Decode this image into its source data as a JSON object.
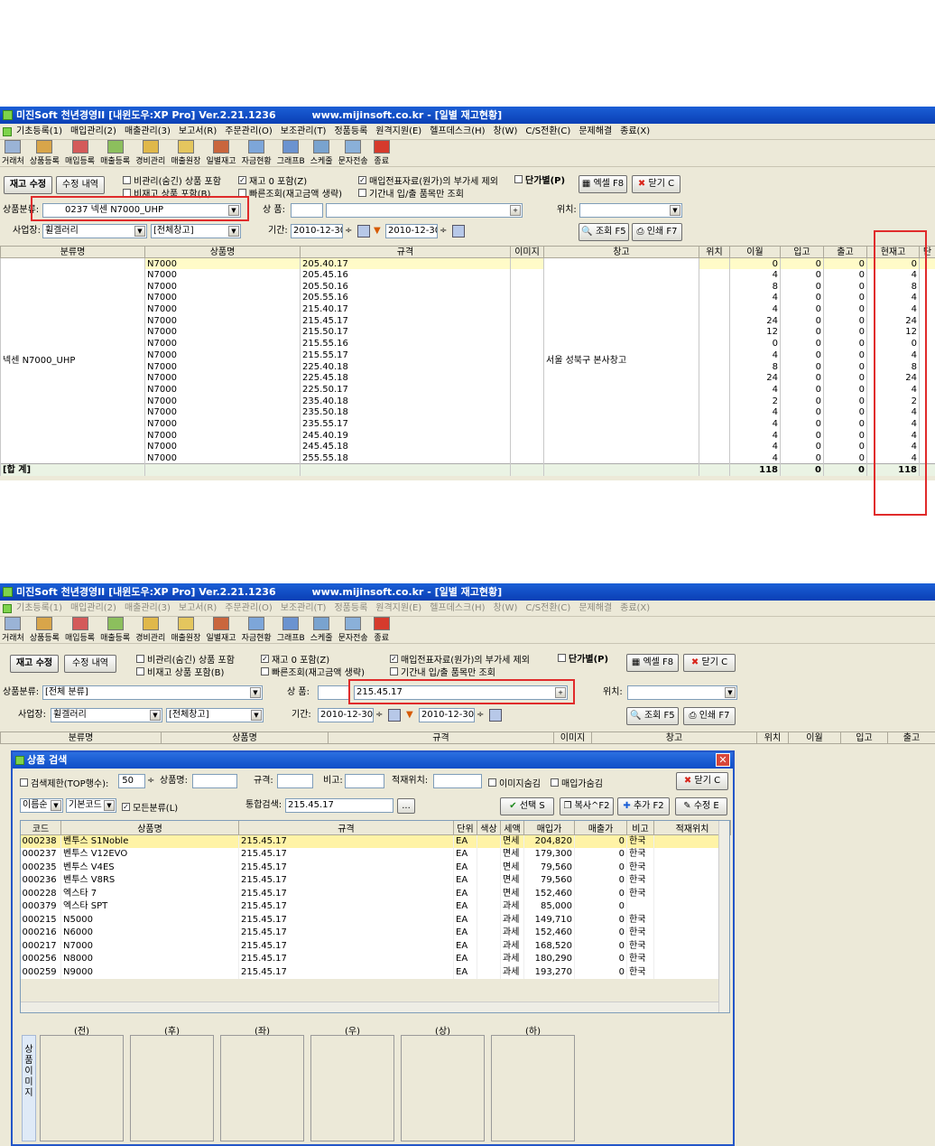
{
  "app_title": "미진Soft 천년경영II [내윈도우:XP Pro] Ver.2.21.1236",
  "url": "www.mijinsoft.co.kr",
  "window_title": "- [일별 재고현황]",
  "menu": [
    "기초등록(1)",
    "매입관리(2)",
    "매출관리(3)",
    "보고서(R)",
    "주문관리(O)",
    "보조관리(T)",
    "정품등록",
    "원격지원(E)",
    "헬프데스크(H)",
    "창(W)",
    "C/S전환(C)",
    "문제해결",
    "종료(X)"
  ],
  "toolbar": [
    "거래처",
    "상품등록",
    "매입등록",
    "매출등록",
    "경비관리",
    "매출원장",
    "일별재고",
    "자금현황",
    "그래프B",
    "스케줄",
    "문자전송",
    "종료"
  ],
  "buttons": {
    "stock_edit": "재고 수정",
    "edit_history": "수정 내역",
    "excel": "엑셀 F8",
    "close": "닫기 C",
    "search": "조회 F5",
    "print": "인쇄 F7"
  },
  "options": {
    "include_hidden": "비관리(숨긴) 상품 포함",
    "include_nonstock": "비재고 상품 포함(B)",
    "include_zero": "재고 0 포함(Z)",
    "quick_search": "빠른조회(재고금액 생략)",
    "exclude_vat": "매입전표자료(원가)의 부가세 제외",
    "period_only": "기간내 입/출 품목만 조회",
    "unit_price": "단가별(P)"
  },
  "filters": {
    "category_label": "상품분류:",
    "product_label": "상 품:",
    "location_label": "위치:",
    "site_label": "사업장:",
    "period_label": "기간:",
    "site_value": "휠겔러리",
    "warehouse_value": "[전체창고]",
    "date_from": "2010-12-30",
    "date_to": "2010-12-30"
  },
  "win1": {
    "category_value": "0237 넥센 N7000_UHP",
    "product_value": "",
    "columns": [
      "분류명",
      "상품명",
      "규격",
      "이미지",
      "창고",
      "위치",
      "이월",
      "입고",
      "출고",
      "현재고",
      "단"
    ],
    "group_name": "넥센 N7000_UHP",
    "warehouse_name": "서울 성북구 본사창고",
    "rows": [
      {
        "name": "N7000",
        "spec": "205.40.17",
        "carry": "0",
        "in": "0",
        "out": "0",
        "stock": "0"
      },
      {
        "name": "N7000",
        "spec": "205.45.16",
        "carry": "4",
        "in": "0",
        "out": "0",
        "stock": "4"
      },
      {
        "name": "N7000",
        "spec": "205.50.16",
        "carry": "8",
        "in": "0",
        "out": "0",
        "stock": "8"
      },
      {
        "name": "N7000",
        "spec": "205.55.16",
        "carry": "4",
        "in": "0",
        "out": "0",
        "stock": "4"
      },
      {
        "name": "N7000",
        "spec": "215.40.17",
        "carry": "4",
        "in": "0",
        "out": "0",
        "stock": "4"
      },
      {
        "name": "N7000",
        "spec": "215.45.17",
        "carry": "24",
        "in": "0",
        "out": "0",
        "stock": "24"
      },
      {
        "name": "N7000",
        "spec": "215.50.17",
        "carry": "12",
        "in": "0",
        "out": "0",
        "stock": "12"
      },
      {
        "name": "N7000",
        "spec": "215.55.16",
        "carry": "0",
        "in": "0",
        "out": "0",
        "stock": "0"
      },
      {
        "name": "N7000",
        "spec": "215.55.17",
        "carry": "4",
        "in": "0",
        "out": "0",
        "stock": "4"
      },
      {
        "name": "N7000",
        "spec": "225.40.18",
        "carry": "8",
        "in": "0",
        "out": "0",
        "stock": "8"
      },
      {
        "name": "N7000",
        "spec": "225.45.18",
        "carry": "24",
        "in": "0",
        "out": "0",
        "stock": "24"
      },
      {
        "name": "N7000",
        "spec": "225.50.17",
        "carry": "4",
        "in": "0",
        "out": "0",
        "stock": "4"
      },
      {
        "name": "N7000",
        "spec": "235.40.18",
        "carry": "2",
        "in": "0",
        "out": "0",
        "stock": "2"
      },
      {
        "name": "N7000",
        "spec": "235.50.18",
        "carry": "4",
        "in": "0",
        "out": "0",
        "stock": "4"
      },
      {
        "name": "N7000",
        "spec": "235.55.17",
        "carry": "4",
        "in": "0",
        "out": "0",
        "stock": "4"
      },
      {
        "name": "N7000",
        "spec": "245.40.19",
        "carry": "4",
        "in": "0",
        "out": "0",
        "stock": "4"
      },
      {
        "name": "N7000",
        "spec": "245.45.18",
        "carry": "4",
        "in": "0",
        "out": "0",
        "stock": "4"
      },
      {
        "name": "N7000",
        "spec": "255.55.18",
        "carry": "4",
        "in": "0",
        "out": "0",
        "stock": "4"
      }
    ],
    "total": {
      "label": "[합 계]",
      "carry": "118",
      "in": "0",
      "out": "0",
      "stock": "118"
    }
  },
  "win2": {
    "category_value": "[전체 분류]",
    "product_value": "215.45.17",
    "columns": [
      "분류명",
      "상품명",
      "규격",
      "이미지",
      "창고",
      "위치",
      "이월",
      "입고",
      "출고"
    ]
  },
  "dialog": {
    "title": "상품 검색",
    "top_limit_label": "검색제한(TOP행수):",
    "top_limit_value": "50",
    "name_label": "상품명:",
    "spec_label": "규격:",
    "note_label": "비고:",
    "location_label": "적재위치:",
    "hide_image": "이미지숨김",
    "include_purchase": "매입가숨김",
    "close": "닫기 C",
    "sort_value": "이름순",
    "code_value": "기본코드",
    "all_category": "모든분류(L)",
    "integrated_label": "통합검색:",
    "integrated_value": "215.45.17",
    "ellipsis": "...",
    "select": "선택 S",
    "copy": "복사^F2",
    "add": "추가 F2",
    "edit": "수정 E",
    "columns": [
      "코드",
      "상품명",
      "규격",
      "단위",
      "색상",
      "세액",
      "매입가",
      "매출가",
      "비고",
      "적재위치"
    ],
    "rows": [
      {
        "code": "000238",
        "name": "벤투스 S1Noble",
        "spec": "215.45.17",
        "unit": "EA",
        "tax": "면세",
        "buy": "204,820",
        "sell": "0",
        "note": "한국"
      },
      {
        "code": "000237",
        "name": "벤투스 V12EVO",
        "spec": "215.45.17",
        "unit": "EA",
        "tax": "면세",
        "buy": "179,300",
        "sell": "0",
        "note": "한국"
      },
      {
        "code": "000235",
        "name": "벤투스 V4ES",
        "spec": "215.45.17",
        "unit": "EA",
        "tax": "면세",
        "buy": "79,560",
        "sell": "0",
        "note": "한국"
      },
      {
        "code": "000236",
        "name": "벤투스 V8RS",
        "spec": "215.45.17",
        "unit": "EA",
        "tax": "면세",
        "buy": "79,560",
        "sell": "0",
        "note": "한국"
      },
      {
        "code": "000228",
        "name": "엑스타 7",
        "spec": "215.45.17",
        "unit": "EA",
        "tax": "면세",
        "buy": "152,460",
        "sell": "0",
        "note": "한국"
      },
      {
        "code": "000379",
        "name": "엑스타 SPT",
        "spec": "215.45.17",
        "unit": "EA",
        "tax": "과세",
        "buy": "85,000",
        "sell": "0",
        "note": ""
      },
      {
        "code": "000215",
        "name": "N5000",
        "spec": "215.45.17",
        "unit": "EA",
        "tax": "과세",
        "buy": "149,710",
        "sell": "0",
        "note": "한국"
      },
      {
        "code": "000216",
        "name": "N6000",
        "spec": "215.45.17",
        "unit": "EA",
        "tax": "과세",
        "buy": "152,460",
        "sell": "0",
        "note": "한국"
      },
      {
        "code": "000217",
        "name": "N7000",
        "spec": "215.45.17",
        "unit": "EA",
        "tax": "과세",
        "buy": "168,520",
        "sell": "0",
        "note": "한국"
      },
      {
        "code": "000256",
        "name": "N8000",
        "spec": "215.45.17",
        "unit": "EA",
        "tax": "과세",
        "buy": "180,290",
        "sell": "0",
        "note": "한국"
      },
      {
        "code": "000259",
        "name": "N9000",
        "spec": "215.45.17",
        "unit": "EA",
        "tax": "과세",
        "buy": "193,270",
        "sell": "0",
        "note": "한국"
      }
    ],
    "image_labels": [
      "(전)",
      "(후)",
      "(좌)",
      "(우)",
      "(상)",
      "(하)"
    ],
    "image_side_label": "상품 이미지"
  },
  "colors": {
    "titlebar": "#0a3fb5",
    "highlight_row": "#fffbc8",
    "annotation_red": "#e02b2b"
  }
}
